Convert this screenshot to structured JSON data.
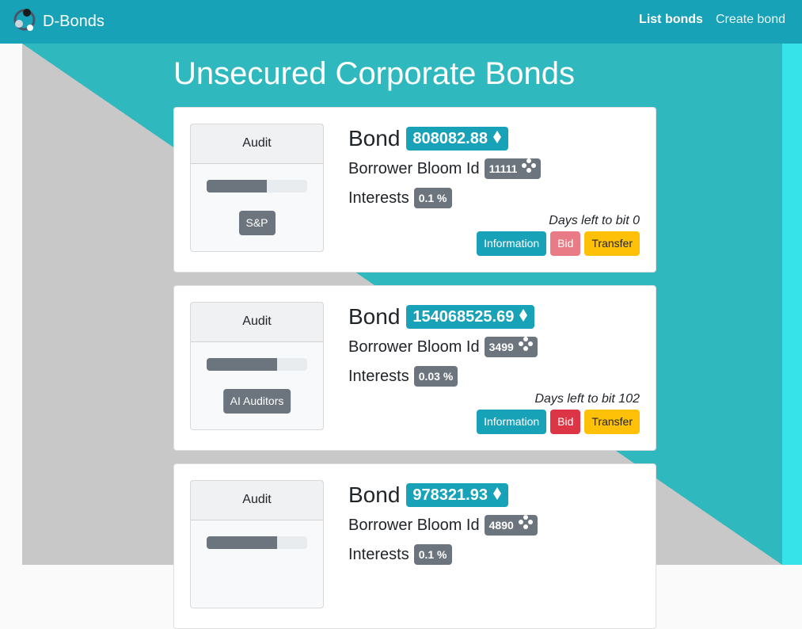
{
  "nav": {
    "brand": "D-Bonds",
    "links": [
      "List bonds",
      "Create bond"
    ]
  },
  "page": {
    "title": "Unsecured Corporate Bonds"
  },
  "bond_word": "Bond",
  "labels": {
    "audit": "Audit",
    "borrower": "Borrower Bloom Id",
    "interests": "Interests",
    "days_left": "Days left to bit",
    "information": "Information",
    "bid": "Bid",
    "transfer": "Transfer"
  },
  "bonds": [
    {
      "amount": "808082.88",
      "borrower_id": "11111",
      "interest": "0.1 %",
      "days_left": "0",
      "auditor": "S&P",
      "audit_progress": 0.6,
      "bid_disabled": true
    },
    {
      "amount": "154068525.69",
      "borrower_id": "3499",
      "interest": "0.03 %",
      "days_left": "102",
      "auditor": "AI Auditors",
      "audit_progress": 0.7,
      "bid_disabled": false
    },
    {
      "amount": "978321.93",
      "borrower_id": "4890",
      "interest": "0.1 %",
      "days_left": "",
      "auditor": "",
      "audit_progress": 0.7,
      "bid_disabled": false
    }
  ],
  "colors": {
    "navbar": "#17a2b8",
    "info": "#17a2b8",
    "danger": "#dc3545",
    "warning": "#ffc107",
    "secondary": "#6c757d",
    "bg_gray": "#c8c8c8",
    "bg_teal": "#2fb9be"
  },
  "icons": {
    "amount": "ether-diamond-icon",
    "borrower": "bloom-icon",
    "brand": "dbonds-logo-icon"
  }
}
